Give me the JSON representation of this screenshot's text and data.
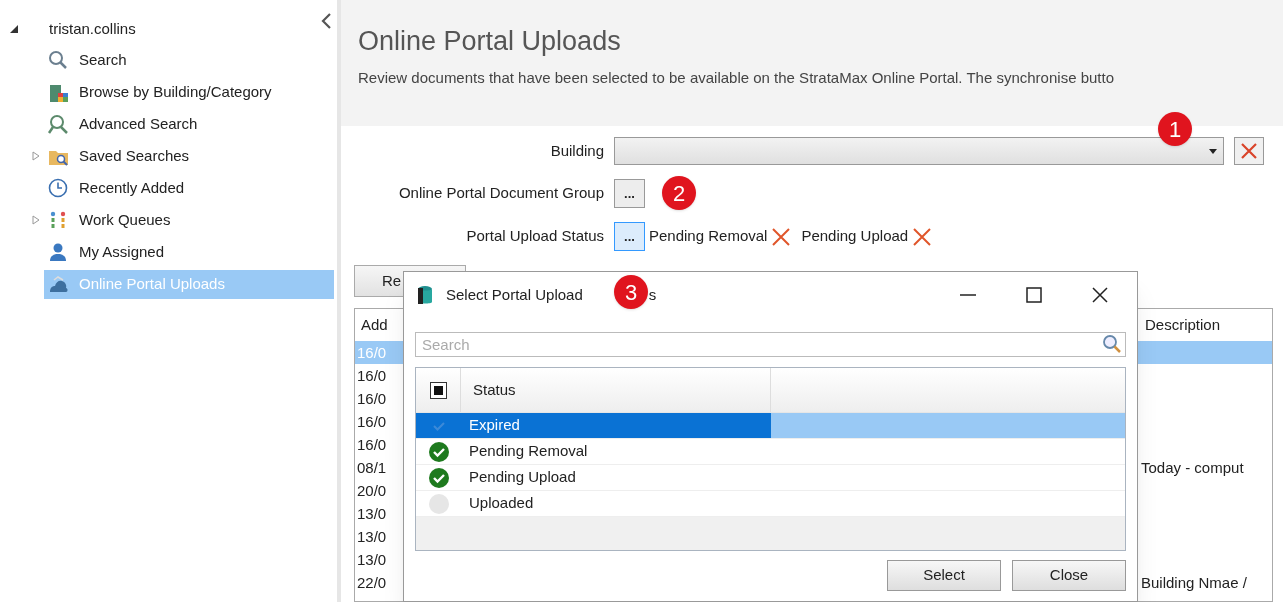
{
  "sidebar": {
    "user": {
      "label": "tristan.collins",
      "expanded": true
    },
    "items": [
      {
        "label": "Search",
        "has_children": false,
        "selected": false
      },
      {
        "label": "Browse by Building/Category",
        "has_children": false,
        "selected": false
      },
      {
        "label": "Advanced Search",
        "has_children": false,
        "selected": false
      },
      {
        "label": "Saved Searches",
        "has_children": true,
        "selected": false
      },
      {
        "label": "Recently Added",
        "has_children": false,
        "selected": false
      },
      {
        "label": "Work Queues",
        "has_children": true,
        "selected": false
      },
      {
        "label": "My Assigned",
        "has_children": false,
        "selected": false
      },
      {
        "label": "Online Portal Uploads",
        "has_children": false,
        "selected": true
      }
    ]
  },
  "page": {
    "title": "Online Portal Uploads",
    "description": "Review documents that have been selected to be available on the StrataMax Online Portal.  The synchronise butto"
  },
  "filters": {
    "building": {
      "label": "Building"
    },
    "document_group": {
      "label": "Online Portal Document Group",
      "button": "...",
      "focused": false
    },
    "status": {
      "label": "Portal Upload Status",
      "button": "...",
      "focused": true,
      "chips": [
        "Pending Removal",
        "Pending Upload"
      ]
    }
  },
  "refresh_button": "Re",
  "table": {
    "columns": [
      "Add",
      "Description"
    ],
    "rows": [
      {
        "date": "16/0",
        "selected": true
      },
      {
        "date": "16/0",
        "selected": false
      },
      {
        "date": "16/0",
        "selected": false
      },
      {
        "date": "16/0",
        "selected": false
      },
      {
        "date": "16/0",
        "selected": false
      },
      {
        "date": "08/1",
        "description": "Today - comput",
        "selected": false
      },
      {
        "date": "20/0",
        "selected": false
      },
      {
        "date": "13/0",
        "selected": false
      },
      {
        "date": "13/0",
        "selected": false
      },
      {
        "date": "13/0",
        "selected": false
      },
      {
        "date": "22/0",
        "description": "Building Nmae /",
        "selected": false
      }
    ]
  },
  "dialog": {
    "title": "Select Portal Upload",
    "title_tail": "s",
    "search_placeholder": "Search",
    "list": {
      "header_partial": true,
      "columns": [
        "Status"
      ],
      "items": [
        {
          "label": "Expired",
          "checked": false,
          "selected": true
        },
        {
          "label": "Pending Removal",
          "checked": true,
          "selected": false
        },
        {
          "label": "Pending Upload",
          "checked": true,
          "selected": false
        },
        {
          "label": "Uploaded",
          "checked": false,
          "selected": false
        }
      ]
    },
    "buttons": [
      "Select",
      "Close"
    ]
  },
  "callouts": [
    "1",
    "2",
    "3"
  ]
}
